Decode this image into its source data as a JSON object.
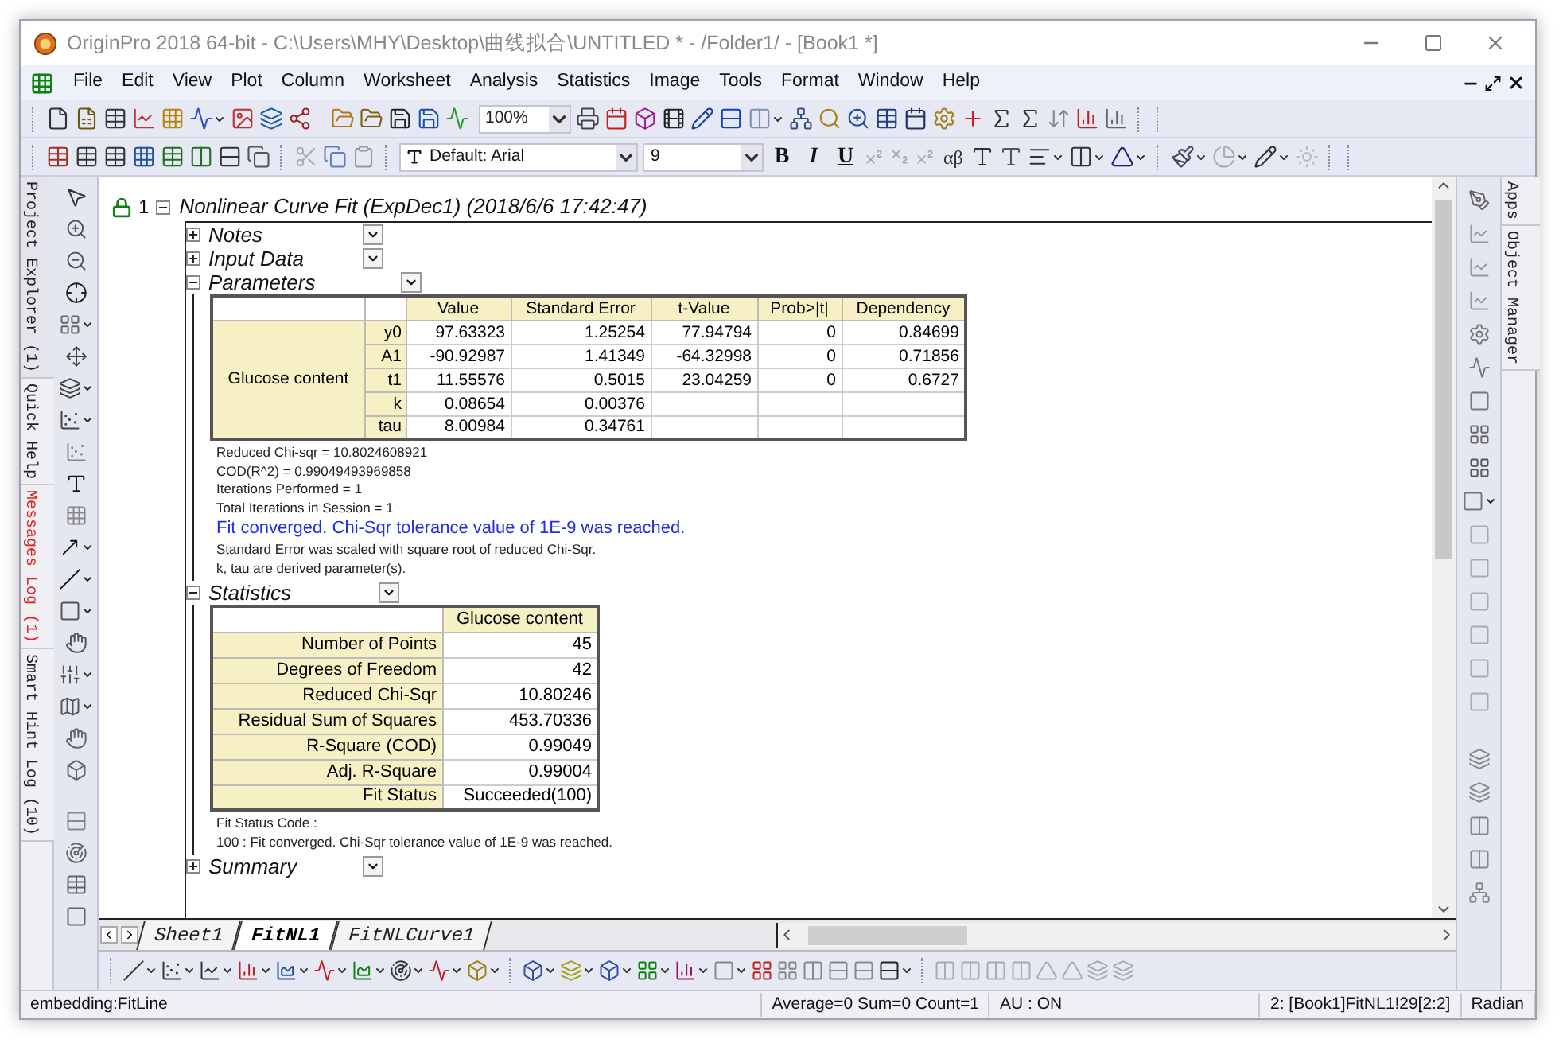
{
  "window": {
    "title": "OriginPro 2018 64-bit - C:\\Users\\MHY\\Desktop\\曲线拟合\\UNTITLED * - /Folder1/ - [Book1 *]"
  },
  "menu": [
    "File",
    "Edit",
    "View",
    "Plot",
    "Column",
    "Worksheet",
    "Analysis",
    "Statistics",
    "Image",
    "Tools",
    "Format",
    "Window",
    "Help"
  ],
  "standard_toolbar": {
    "zoom": "100%"
  },
  "format_toolbar": {
    "font": "Default: Arial",
    "size": "9",
    "styles": [
      "B",
      "I",
      "U"
    ],
    "greek": "αβ"
  },
  "left_tabs": [
    {
      "label": "Project Explorer (1)",
      "alert": false
    },
    {
      "label": "Quick Help",
      "alert": false
    },
    {
      "label": "Messages Log (1)",
      "alert": true
    },
    {
      "label": "Smart Hint Log (10)",
      "alert": false
    }
  ],
  "right_tabs": [
    "Apps",
    "Object Manager"
  ],
  "report": {
    "index": "1",
    "title": "Nonlinear Curve Fit (ExpDec1) (2018/6/6 17:42:47)",
    "sections": [
      {
        "kind": "plain",
        "label": "Notes",
        "expanded": false
      },
      {
        "kind": "plain",
        "label": "Input Data",
        "expanded": false
      },
      {
        "kind": "parameters",
        "label": "Parameters",
        "expanded": true,
        "group": "Glucose content",
        "columns": [
          "Value",
          "Standard Error",
          "t-Value",
          "Prob>|t|",
          "Dependency"
        ],
        "rows": [
          {
            "name": "y0",
            "cells": [
              "97.63323",
              "1.25254",
              "77.94794",
              "0",
              "0.84699"
            ]
          },
          {
            "name": "A1",
            "cells": [
              "-90.92987",
              "1.41349",
              "-64.32998",
              "0",
              "0.71856"
            ]
          },
          {
            "name": "t1",
            "cells": [
              "11.55576",
              "0.5015",
              "23.04259",
              "0",
              "0.6727"
            ]
          },
          {
            "name": "k",
            "cells": [
              "0.08654",
              "0.00376"
            ]
          },
          {
            "name": "tau",
            "cells": [
              "8.00984",
              "0.34761"
            ]
          }
        ],
        "notes": [
          {
            "text": "Reduced Chi-sqr = 10.8024608921",
            "highlight": false
          },
          {
            "text": "COD(R^2) = 0.99049493969858",
            "highlight": false
          },
          {
            "text": "Iterations Performed = 1",
            "highlight": false
          },
          {
            "text": "Total Iterations in Session = 1",
            "highlight": false
          },
          {
            "text": "Fit converged. Chi-Sqr tolerance value of 1E-9 was reached.",
            "highlight": true
          },
          {
            "text": "Standard Error was scaled with square root of reduced Chi-Sqr.",
            "highlight": false
          },
          {
            "text": "k, tau are derived parameter(s).",
            "highlight": false
          }
        ]
      },
      {
        "kind": "statistics",
        "label": "Statistics",
        "expanded": true,
        "column": "Glucose content",
        "rows": [
          {
            "label": "Number of Points",
            "value": "45"
          },
          {
            "label": "Degrees of Freedom",
            "value": "42"
          },
          {
            "label": "Reduced Chi-Sqr",
            "value": "10.80246"
          },
          {
            "label": "Residual Sum of Squares",
            "value": "453.70336"
          },
          {
            "label": "R-Square (COD)",
            "value": "0.99049"
          },
          {
            "label": "Adj. R-Square",
            "value": "0.99004"
          },
          {
            "label": "Fit Status",
            "value": "Succeeded(100)"
          }
        ],
        "notes": [
          {
            "text": "Fit Status Code :",
            "highlight": false
          },
          {
            "text": "100 : Fit converged. Chi-Sqr tolerance value of 1E-9 was reached.",
            "highlight": false
          }
        ]
      },
      {
        "kind": "plain",
        "label": "Summary",
        "expanded": false
      }
    ]
  },
  "sheet_tabs": [
    {
      "label": "Sheet1",
      "selected": false
    },
    {
      "label": "FitNL1",
      "selected": true
    },
    {
      "label": "FitNLCurve1",
      "selected": false
    }
  ],
  "status_bar": [
    "embedding:FitLine",
    "Average=0 Sum=0 Count=1",
    "AU : ON",
    "2: [Book1]FitNL1!29[2:2]",
    "Radian"
  ]
}
